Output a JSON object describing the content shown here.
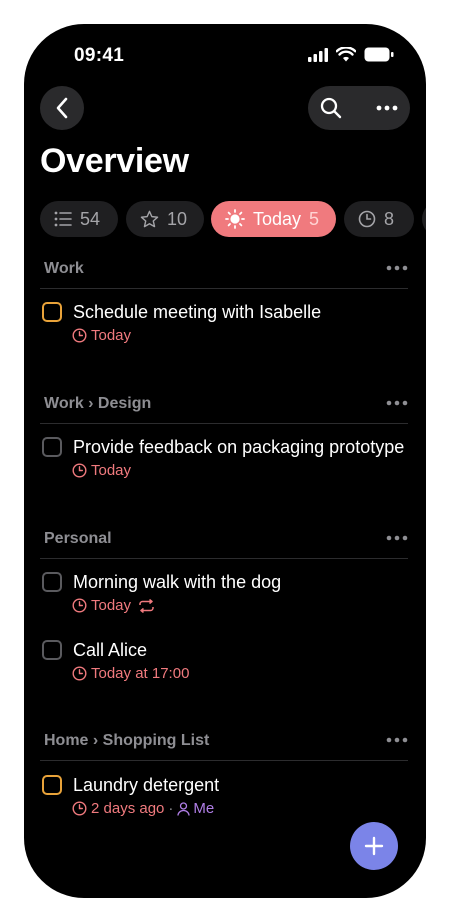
{
  "status": {
    "time": "09:41"
  },
  "header": {
    "title": "Overview"
  },
  "filters": [
    {
      "icon": "list-icon",
      "label": "",
      "count": "54"
    },
    {
      "icon": "star-icon",
      "label": "",
      "count": "10"
    },
    {
      "icon": "sun-icon",
      "label": "Today",
      "count": "5",
      "active": true
    },
    {
      "icon": "clock-icon",
      "label": "",
      "count": "8"
    }
  ],
  "sections": [
    {
      "title": "Work",
      "tasks": [
        {
          "title": "Schedule meeting with Isabelle",
          "due": "Today",
          "checkbox_color": "orange"
        }
      ]
    },
    {
      "title": "Work › Design",
      "tasks": [
        {
          "title": "Provide feedback on packaging prototype",
          "due": "Today"
        }
      ]
    },
    {
      "title": "Personal",
      "tasks": [
        {
          "title": "Morning walk with the dog",
          "due": "Today",
          "repeats": true
        },
        {
          "title": "Call Alice",
          "due": "Today at 17:00"
        }
      ]
    },
    {
      "title": "Home › Shopping List",
      "tasks": [
        {
          "title": "Laundry detergent",
          "due": "2 days ago",
          "separator": "·",
          "assignee": "Me",
          "checkbox_color": "orange"
        }
      ]
    }
  ],
  "colors": {
    "accent": "#f07a7e",
    "fab": "#7b84e8",
    "assignee": "#b07ee6",
    "checkbox_orange": "#e9a33a"
  }
}
